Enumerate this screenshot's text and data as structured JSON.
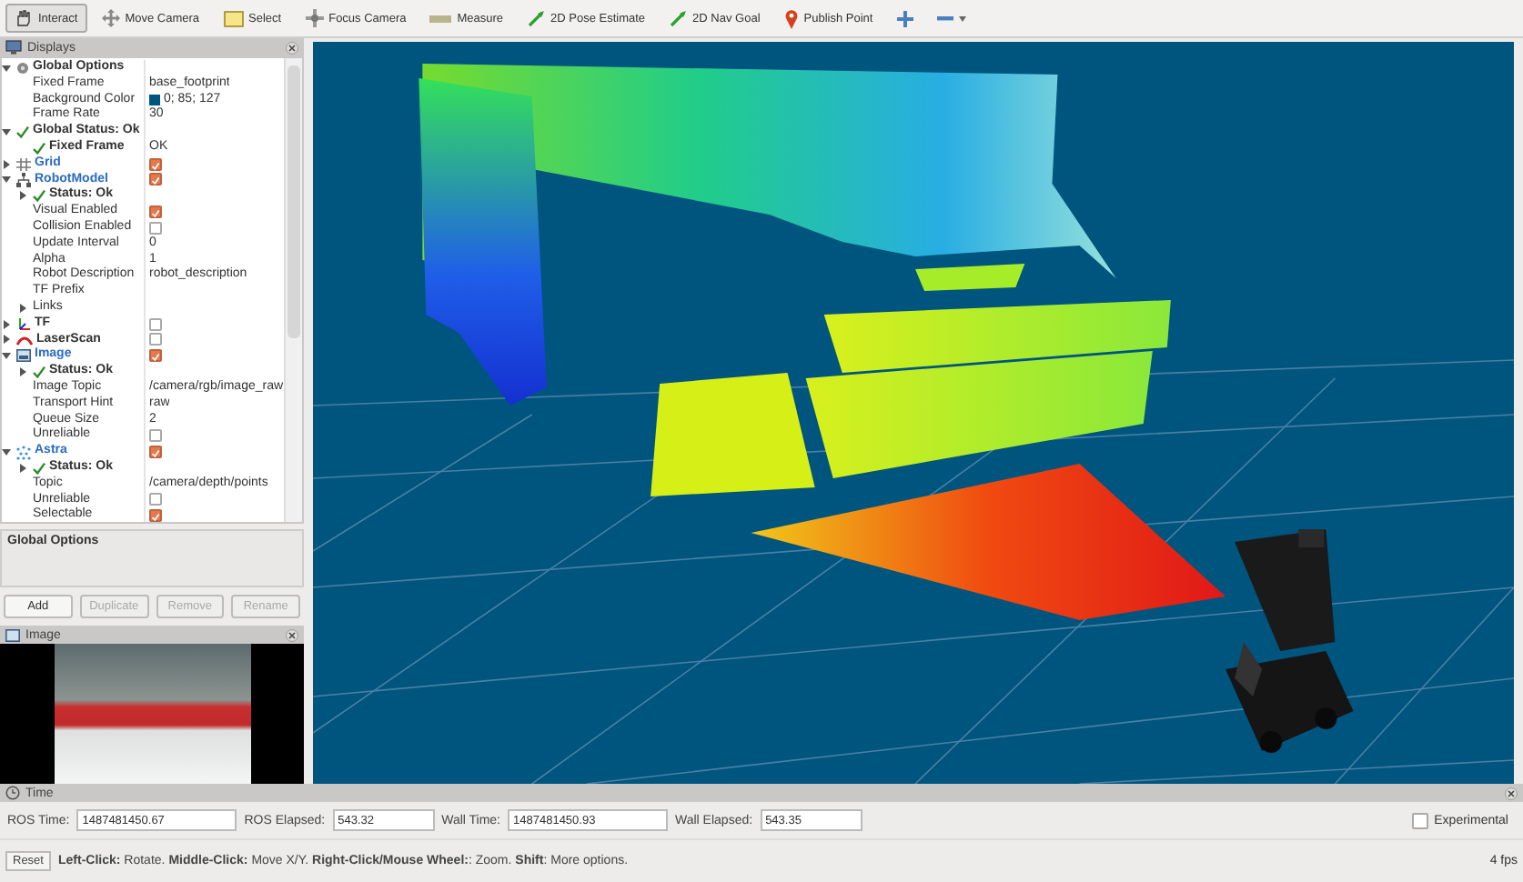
{
  "toolbar": {
    "tools": [
      {
        "label": "Interact",
        "kind": "hand",
        "selected": true
      },
      {
        "label": "Move Camera",
        "kind": "move",
        "selected": false
      },
      {
        "label": "Select",
        "kind": "select",
        "selected": false
      },
      {
        "label": "Focus Camera",
        "kind": "focus",
        "selected": false
      },
      {
        "label": "Measure",
        "kind": "measure",
        "selected": false
      },
      {
        "label": "2D Pose Estimate",
        "kind": "pose",
        "selected": false
      },
      {
        "label": "2D Nav Goal",
        "kind": "goal",
        "selected": false
      },
      {
        "label": "Publish Point",
        "kind": "point",
        "selected": false
      }
    ]
  },
  "displays": {
    "title": "Displays",
    "rows": [
      {
        "label": "Global Options",
        "kind": "group",
        "expanded": true,
        "children": [
          {
            "label": "Fixed Frame",
            "kind": "text",
            "value": "base_footprint"
          },
          {
            "label": "Background Color",
            "kind": "color",
            "value": "0; 85; 127",
            "color": "#00557f"
          },
          {
            "label": "Frame Rate",
            "kind": "text",
            "value": "30"
          }
        ]
      },
      {
        "label": "Global Status: Ok",
        "kind": "status",
        "expanded": true,
        "children": [
          {
            "label": "Fixed Frame",
            "kind": "status",
            "value": "OK"
          }
        ]
      },
      {
        "label": "Grid",
        "kind": "grid",
        "expanded": false,
        "checked": true
      },
      {
        "label": "RobotModel",
        "kind": "robot_model",
        "expanded": true,
        "checked": true,
        "children": [
          {
            "label": "Status: Ok",
            "kind": "status",
            "expanded": false
          },
          {
            "label": "Visual Enabled",
            "kind": "checkbox",
            "checked": true
          },
          {
            "label": "Collision Enabled",
            "kind": "checkbox",
            "checked": false
          },
          {
            "label": "Update Interval",
            "kind": "text",
            "value": "0"
          },
          {
            "label": "Alpha",
            "kind": "text",
            "value": "1"
          },
          {
            "label": "Robot Description",
            "kind": "text",
            "value": "robot_description"
          },
          {
            "label": "TF Prefix",
            "kind": "text"
          },
          {
            "label": "Links",
            "kind": "text",
            "expanded": false
          }
        ]
      },
      {
        "label": "TF",
        "kind": "tf",
        "expanded": false,
        "checked": false
      },
      {
        "label": "LaserScan",
        "kind": "laser_scan",
        "expanded": false,
        "checked": false
      },
      {
        "label": "Image",
        "kind": "image",
        "expanded": true,
        "checked": true,
        "children": [
          {
            "label": "Status: Ok",
            "kind": "status",
            "expanded": false
          },
          {
            "label": "Image Topic",
            "kind": "text",
            "value": "/camera/rgb/image_raw"
          },
          {
            "label": "Transport Hint",
            "kind": "text",
            "value": "raw"
          },
          {
            "label": "Queue Size",
            "kind": "text",
            "value": "2"
          },
          {
            "label": "Unreliable",
            "kind": "checkbox",
            "checked": false
          }
        ]
      },
      {
        "label": "Astra",
        "kind": "point_cloud",
        "expanded": true,
        "checked": true,
        "children": [
          {
            "label": "Status: Ok",
            "kind": "status",
            "expanded": false
          },
          {
            "label": "Topic",
            "kind": "text",
            "value": "/camera/depth/points"
          },
          {
            "label": "Unreliable",
            "kind": "checkbox",
            "checked": false
          },
          {
            "label": "Selectable",
            "kind": "checkbox",
            "checked": true
          }
        ]
      }
    ],
    "description_title": "Global Options",
    "buttons": [
      {
        "label": "Add",
        "disabled": false
      },
      {
        "label": "Duplicate",
        "disabled": true
      },
      {
        "label": "Remove",
        "disabled": true
      },
      {
        "label": "Rename",
        "disabled": true
      }
    ]
  },
  "image_panel": {
    "title": "Image"
  },
  "time_panel": {
    "title": "Time",
    "fields": [
      {
        "label": "ROS Time:",
        "value": "1487481450.67"
      },
      {
        "label": "ROS Elapsed:",
        "value": "543.32"
      },
      {
        "label": "Wall Time:",
        "value": "1487481450.93"
      },
      {
        "label": "Wall Elapsed:",
        "value": "543.35"
      }
    ],
    "experimental": {
      "label": "Experimental",
      "checked": false
    }
  },
  "status_bar": {
    "reset": "Reset",
    "hint": "**Left-Click:** Rotate. **Middle-Click:** Move X/Y. **Right-Click/Mouse Wheel:**: Zoom. **Shift**: More options.",
    "fps": "4 fps"
  }
}
